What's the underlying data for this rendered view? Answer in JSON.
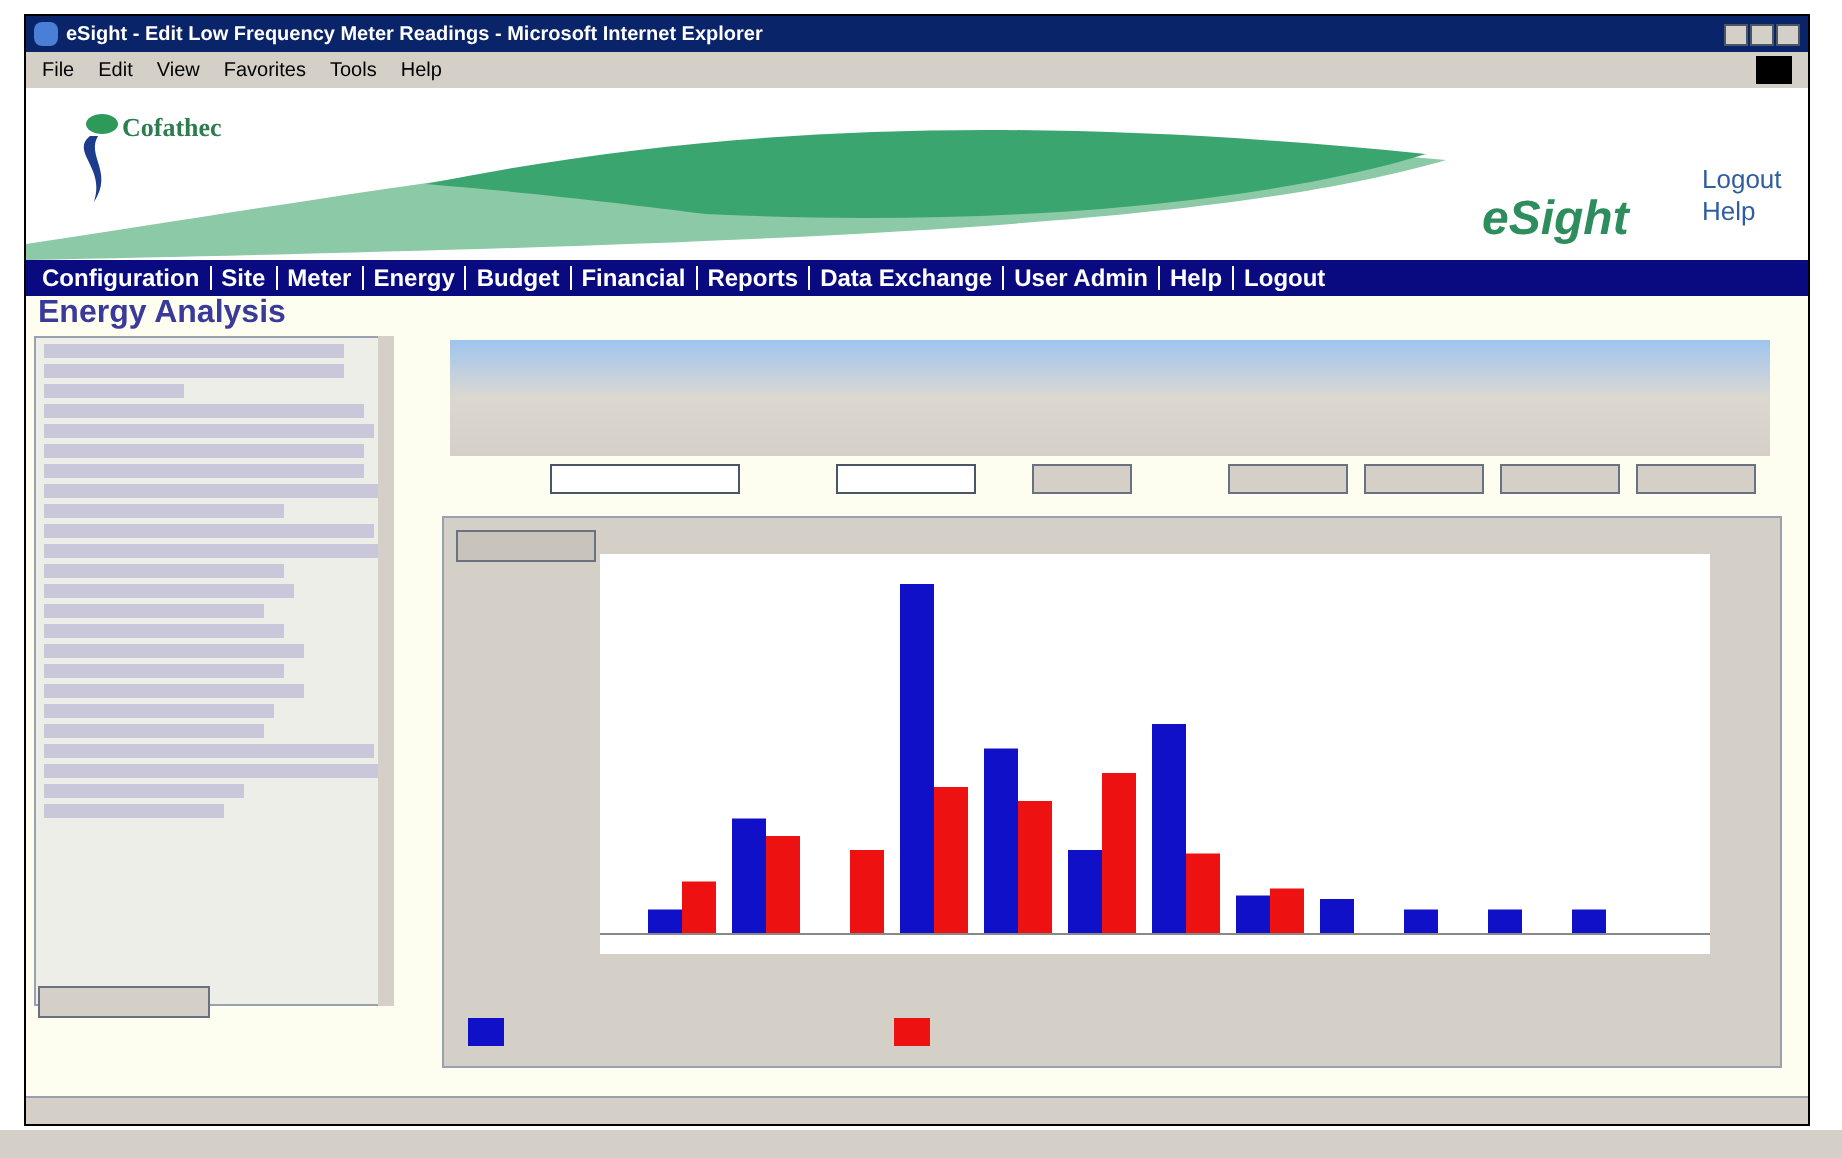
{
  "window": {
    "title": "eSight - Edit Low Frequency Meter Readings - Microsoft Internet Explorer"
  },
  "menu": [
    "File",
    "Edit",
    "View",
    "Favorites",
    "Tools",
    "Help"
  ],
  "banner": {
    "company": "Cofathec",
    "product": "eSight",
    "links": [
      "Logout",
      "Help"
    ]
  },
  "nav": [
    "Configuration",
    "Site",
    "Meter",
    "Energy",
    "Budget",
    "Financial",
    "Reports",
    "Data Exchange",
    "User Admin",
    "Help",
    "Logout"
  ],
  "page": {
    "heading": "Energy Analysis"
  }
}
